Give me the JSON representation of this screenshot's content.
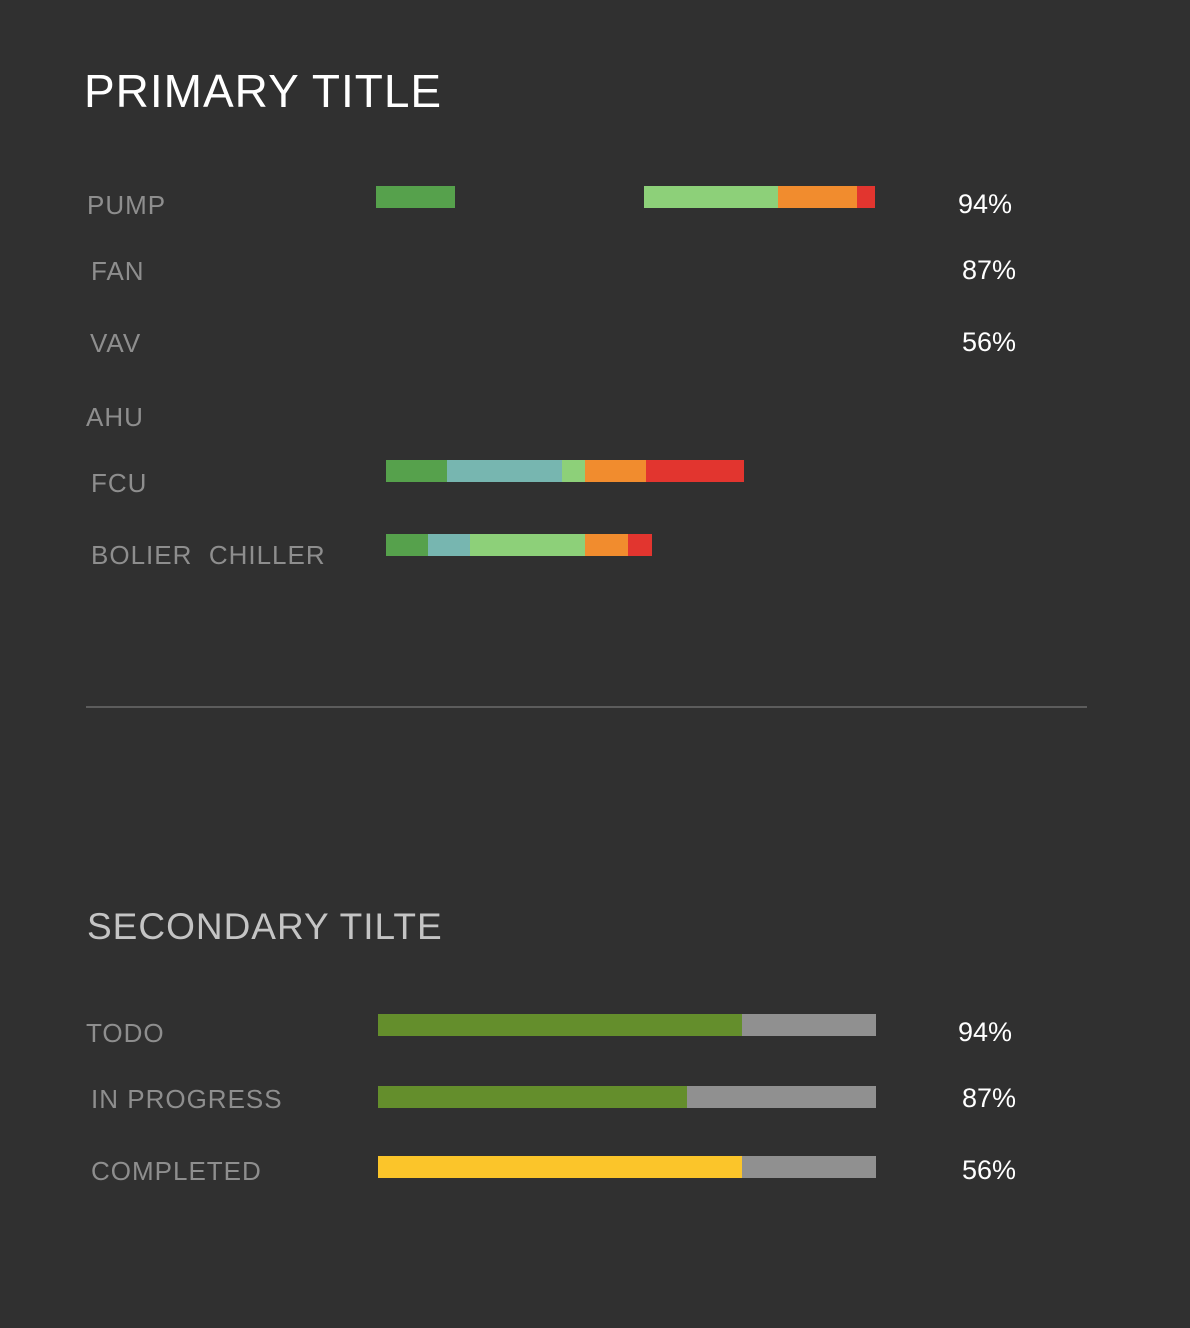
{
  "primary": {
    "title": "PRIMARY TITLE",
    "rows": [
      {
        "label": "PUMP",
        "value": "94%",
        "segments": [
          {
            "color": "#56a14c"
          },
          {
            "color": "#8dd079"
          },
          {
            "color": "#f18c2e"
          },
          {
            "color": "#e2352f"
          }
        ]
      },
      {
        "label": "FAN",
        "value": "87%"
      },
      {
        "label": "VAV",
        "value": "56%"
      },
      {
        "label": "AHU"
      },
      {
        "label": "FCU",
        "segments": [
          {
            "color": "#56a14c"
          },
          {
            "color": "#77b6b0"
          },
          {
            "color": "#8dd079"
          },
          {
            "color": "#f18c2e"
          },
          {
            "color": "#e2352f"
          }
        ]
      },
      {
        "label": "BOLIER  CHILLER",
        "segments": [
          {
            "color": "#56a14c"
          },
          {
            "color": "#77b6b0"
          },
          {
            "color": "#8dd079"
          },
          {
            "color": "#f18c2e"
          },
          {
            "color": "#e2352f"
          }
        ]
      }
    ]
  },
  "secondary": {
    "title": "SECONDARY TILTE",
    "track_color": "#909090",
    "rows": [
      {
        "label": "TODO",
        "value": "94%",
        "fill_fraction": 0.73,
        "fill_color": "#648e2c"
      },
      {
        "label": "IN PROGRESS",
        "value": "87%",
        "fill_fraction": 0.62,
        "fill_color": "#648e2c"
      },
      {
        "label": "COMPLETED",
        "value": "56%",
        "fill_fraction": 0.73,
        "fill_color": "#fbc52a"
      }
    ]
  }
}
